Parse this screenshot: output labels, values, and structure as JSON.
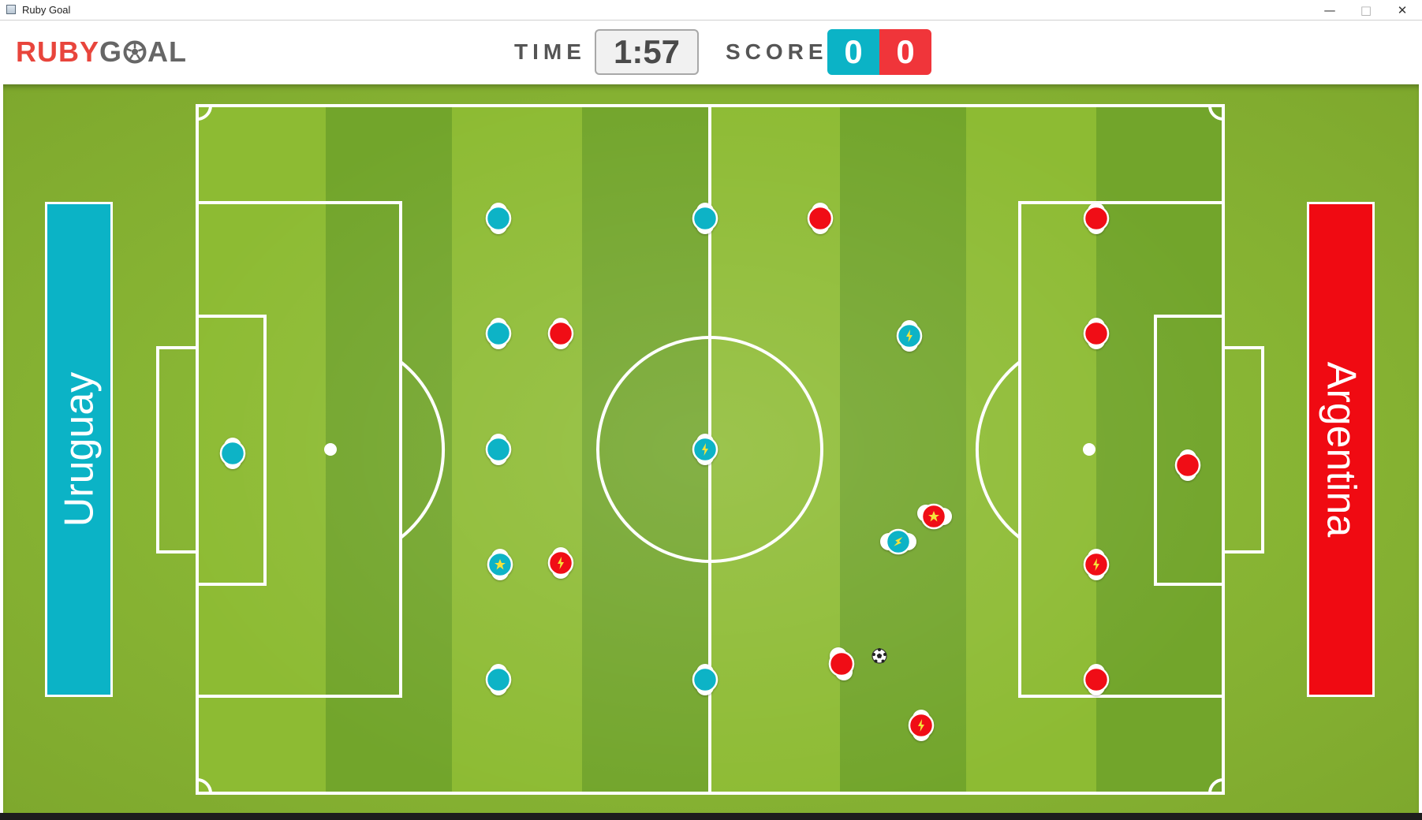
{
  "window": {
    "title": "Ruby Goal",
    "controls": {
      "minimize": "—",
      "maximize": "□",
      "close": "✕"
    }
  },
  "header": {
    "logo_ruby": "RUBY",
    "logo_goal": "G",
    "logo_goal_end": "AL",
    "time_label": "TIME",
    "time_value": "1:57",
    "score_label": "SCORE",
    "score_home": "0",
    "score_away": "0"
  },
  "teams": {
    "home": {
      "name": "Uruguay",
      "color": "#0bb3c6"
    },
    "away": {
      "name": "Argentina",
      "color": "#f00a12"
    }
  },
  "colors": {
    "logo_red": "#e8453c",
    "logo_gray": "#666666",
    "stripe_light": "#8dbb33",
    "stripe_dark": "#72a52b",
    "lines": "#ffffff"
  }
}
